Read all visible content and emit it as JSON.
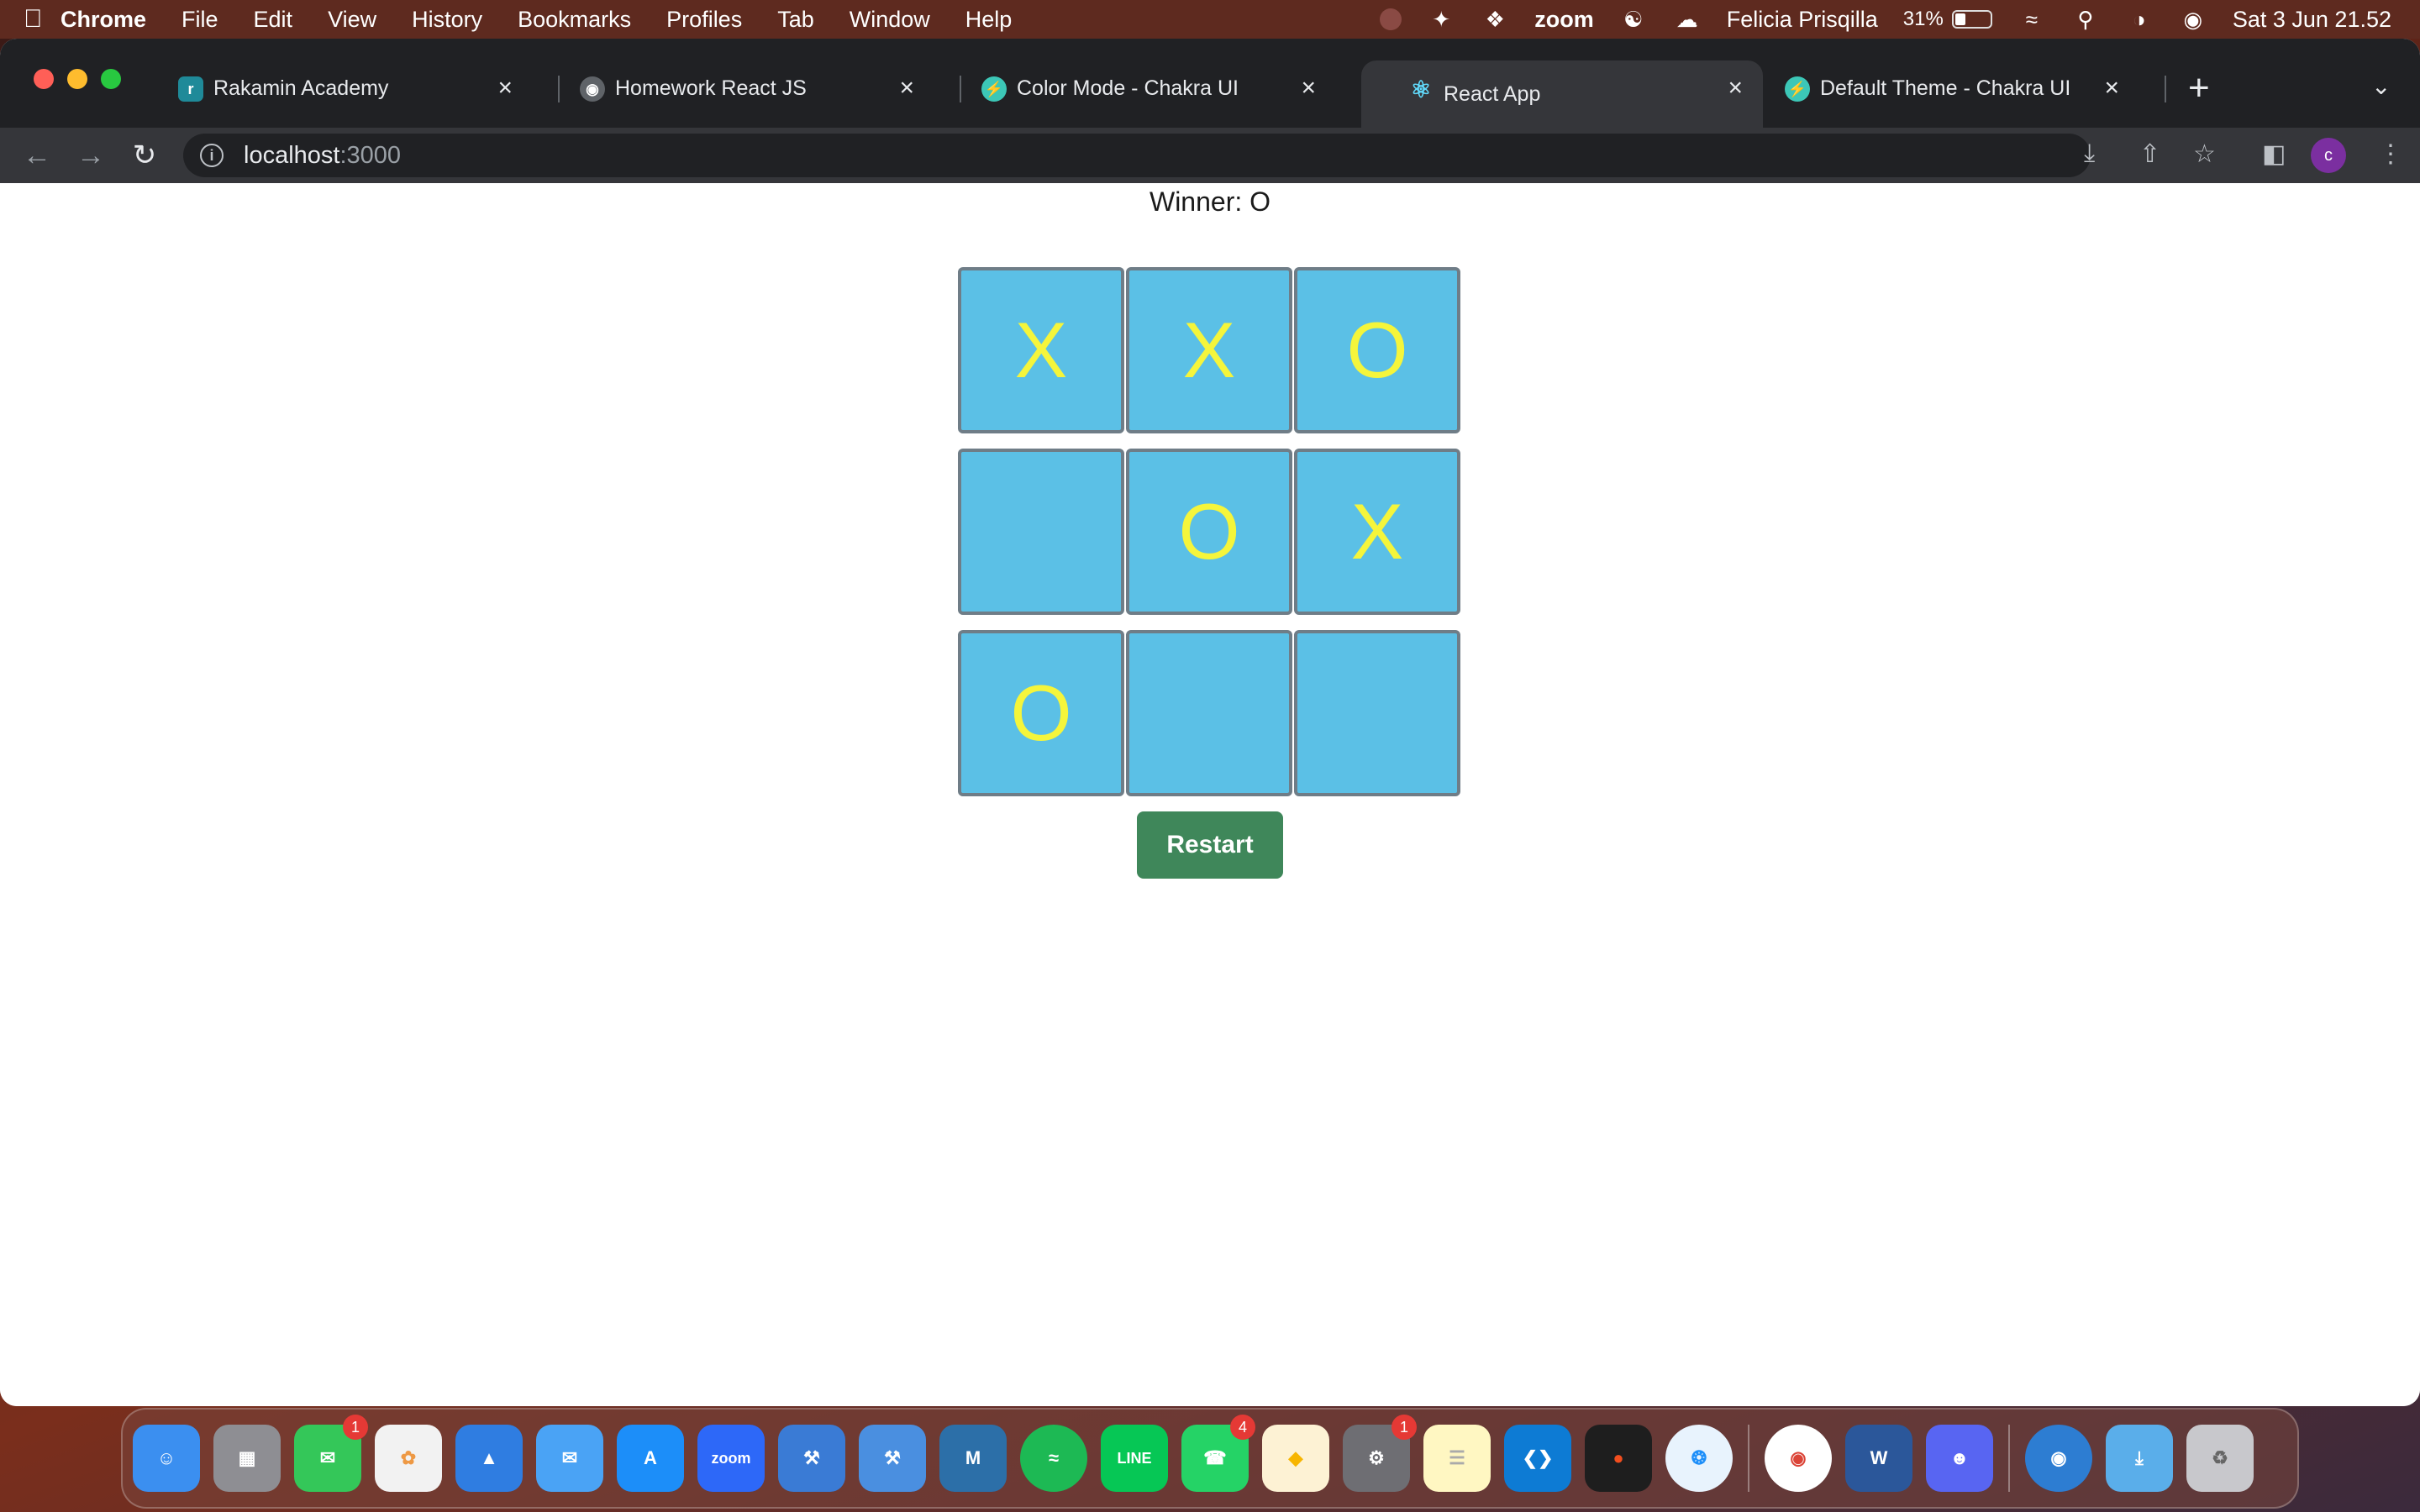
{
  "menubar": {
    "app": "Chrome",
    "items": [
      "File",
      "Edit",
      "View",
      "History",
      "Bookmarks",
      "Profiles",
      "Tab",
      "Window",
      "Help"
    ],
    "zoom": "zoom",
    "user": "Felicia Prisqilla",
    "battery": "31%",
    "battery_level": 0.31,
    "datetime": "Sat 3 Jun  21.52"
  },
  "tabs": [
    {
      "title": "Rakamin Academy",
      "icon": "rakamin-icon"
    },
    {
      "title": "Homework React JS",
      "icon": "globe-icon"
    },
    {
      "title": "Color Mode - Chakra UI",
      "icon": "chakra-icon"
    },
    {
      "title": "React App",
      "icon": "react-icon",
      "active": true
    },
    {
      "title": "Default Theme - Chakra UI",
      "icon": "chakra-icon"
    }
  ],
  "address": {
    "host": "localhost",
    "port": ":3000"
  },
  "game": {
    "status": "Winner: O",
    "squares": [
      "X",
      "X",
      "O",
      "",
      "O",
      "X",
      "O",
      "",
      ""
    ],
    "restart_label": "Restart"
  },
  "colors": {
    "square_bg": "#5bc0e6",
    "mark": "#f5f53b",
    "restart_bg": "#3f875a"
  },
  "dock": {
    "badges": {
      "messages": "1",
      "whatsapp": "4",
      "settings": "1"
    }
  }
}
